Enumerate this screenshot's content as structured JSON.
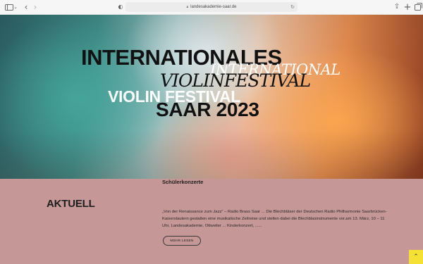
{
  "browser": {
    "url": "landesakademie-saar.de",
    "icons": {
      "sidebar": "sidebar-icon",
      "back": "chevron-left-icon",
      "forward": "chevron-right-icon",
      "privacy": "shield-icon",
      "reload": "reload-icon",
      "share": "share-icon",
      "new_tab": "plus-icon",
      "tabs": "tab-overview-icon"
    }
  },
  "hero": {
    "line1": "INTERNATIONALES",
    "line2": "INTERNATIONAL",
    "line3": "VIOLINFESTIVAL",
    "line4": "VIOLIN FESTIVAL",
    "line5": "SAAR 2023"
  },
  "news": {
    "heading": "AKTUELL",
    "article": {
      "title": "Schülerkonzerte",
      "excerpt": "„Von der Renaissance zum Jazz“ – Radio Brass Saar ... Die Blechbläser der Deutschen Radio Philharmonie Saarbrücken-Kaiserslautern gestalten eine musikalische Zeitreise und stellen dabei die Blechblasinstrumente vor.am 13. März, 10 – 11 Uhr, Landesakademie, Ottweiler ... Kinderkonzert, ......",
      "read_more": "MEHR LESEN"
    }
  },
  "colors": {
    "news_background": "#c69797",
    "scroll_top_button": "#f4e134"
  }
}
